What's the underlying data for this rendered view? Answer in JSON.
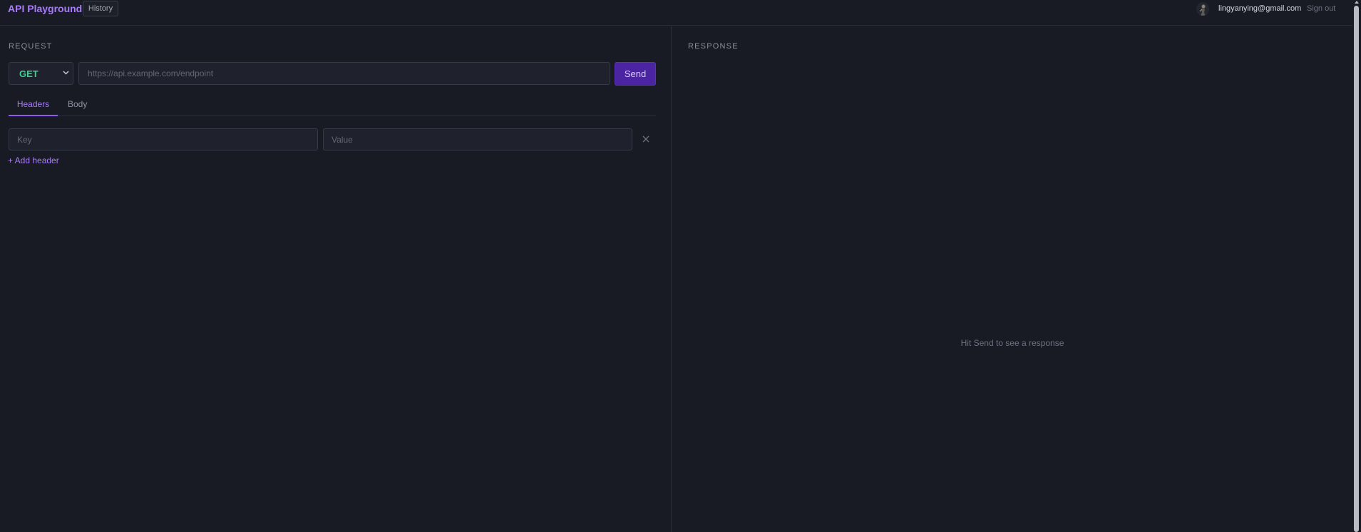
{
  "header": {
    "brand": "API Playground",
    "history_label": "History",
    "user_email": "lingyanying@gmail.com",
    "sign_out_label": "Sign out"
  },
  "request": {
    "section_label": "REQUEST",
    "method": "GET",
    "url_placeholder": "https://api.example.com/endpoint",
    "send_label": "Send",
    "tabs": [
      {
        "label": "Headers",
        "active": true
      },
      {
        "label": "Body",
        "active": false
      }
    ],
    "headers": [
      {
        "key_placeholder": "Key",
        "value_placeholder": "Value"
      }
    ],
    "add_header_label": "+ Add header"
  },
  "response": {
    "section_label": "RESPONSE",
    "empty_message": "Hit Send to see a response"
  },
  "colors": {
    "background": "#181b24",
    "accent": "#a97cf8",
    "send_button": "#4a24a1",
    "method_get": "#3fcf8e"
  },
  "icons": {
    "avatar": "avatar-image",
    "method_dropdown": "chevron-down-icon",
    "remove_header": "close-icon"
  }
}
